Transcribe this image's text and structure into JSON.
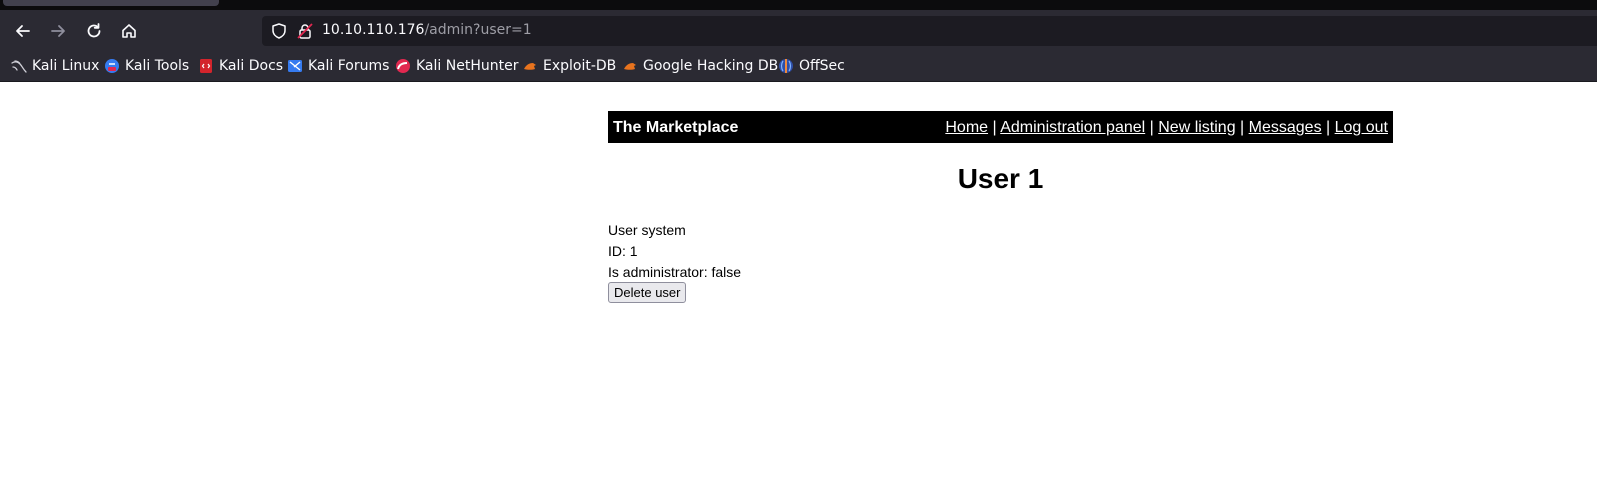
{
  "browser": {
    "url_host": "10.10.110.176",
    "url_path": "/admin?user=1",
    "bookmarks": [
      {
        "label": "Kali Linux",
        "icon": "kali-dragon-icon"
      },
      {
        "label": "Kali Tools",
        "icon": "kali-tools-icon"
      },
      {
        "label": "Kali Docs",
        "icon": "kali-docs-icon"
      },
      {
        "label": "Kali Forums",
        "icon": "kali-forums-icon"
      },
      {
        "label": "Kali NetHunter",
        "icon": "kali-nethunter-icon"
      },
      {
        "label": "Exploit-DB",
        "icon": "exploit-db-icon"
      },
      {
        "label": "Google Hacking DB",
        "icon": "google-hacking-db-icon"
      },
      {
        "label": "OffSec",
        "icon": "offsec-icon"
      }
    ]
  },
  "header": {
    "title": "The Marketplace",
    "nav": {
      "home": "Home",
      "admin": "Administration panel",
      "new_listing": "New listing",
      "messages": "Messages",
      "logout": "Log out",
      "separator": " | "
    }
  },
  "main": {
    "heading": "User 1",
    "username_line": "User system",
    "id_line": "ID: 1",
    "admin_line": "Is administrator: false",
    "delete_button": "Delete user"
  },
  "colors": {
    "chrome": "#2b2a33",
    "urlbar": "#1c1b22",
    "header_bg": "#000000",
    "header_text": "#ffffff"
  }
}
